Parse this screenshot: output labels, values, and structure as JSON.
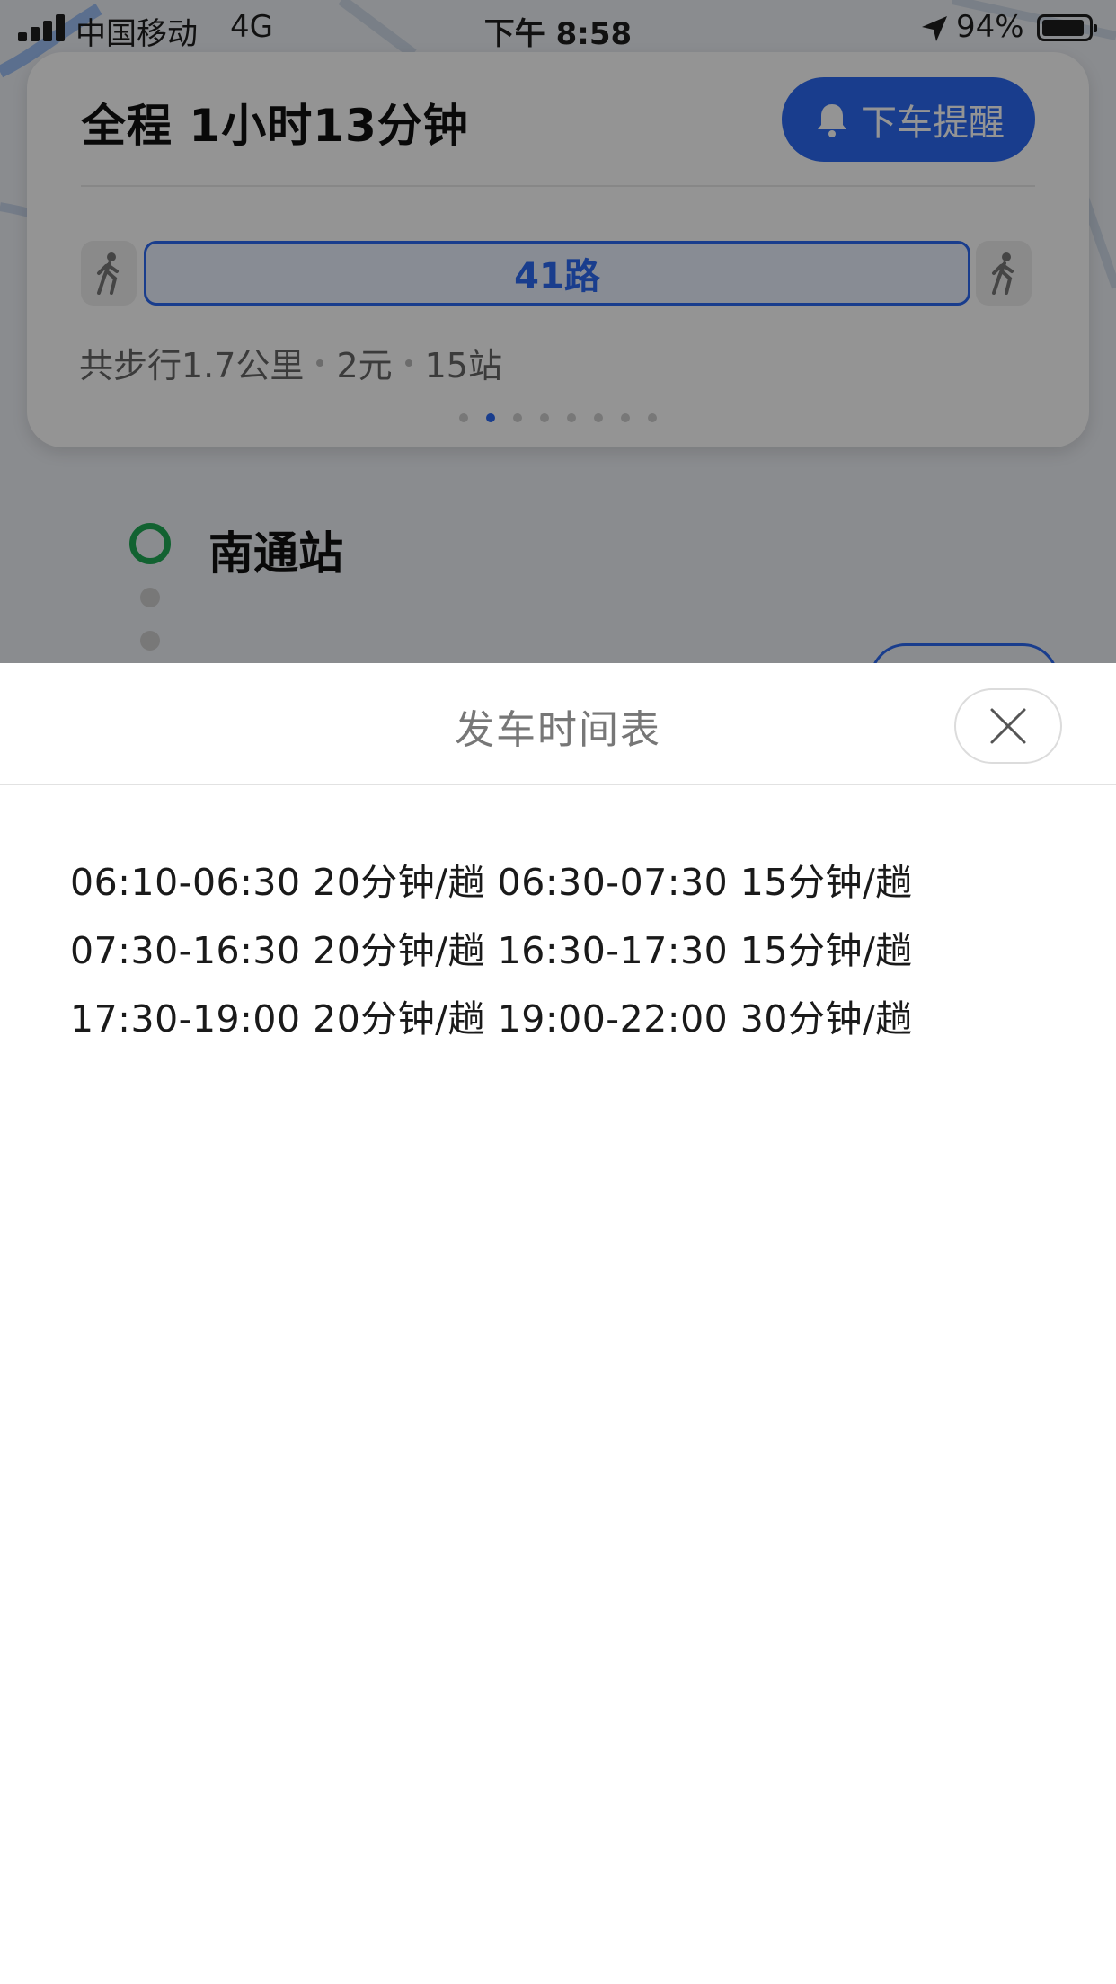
{
  "status_bar": {
    "carrier": "中国移动",
    "network": "4G",
    "time": "下午 8:58",
    "battery_percent": "94%"
  },
  "route_card": {
    "title": "全程  1小时13分钟",
    "remind_button": "下车提醒",
    "bus_line": "41路",
    "walk_distance": "共步行1.7公里",
    "fare": "2元",
    "stops": "15站",
    "page_count": 8,
    "active_page": 2
  },
  "station": {
    "name": "南通站"
  },
  "sheet": {
    "title": "发车时间表",
    "schedule_lines": [
      "06:10-06:30 20分钟/趟 06:30-07:30 15分钟/趟",
      "07:30-16:30 20分钟/趟 16:30-17:30 15分钟/趟",
      "17:30-19:00 20分钟/趟 19:00-22:00 30分钟/趟"
    ]
  },
  "colors": {
    "accent": "#2b6af3",
    "station_ring": "#1faa55",
    "overlay": "rgba(0,0,0,0.42)"
  },
  "icons": {
    "remind": "bell-icon",
    "walk": "pedestrian-icon",
    "close": "close-icon",
    "location": "location-arrow-icon"
  }
}
